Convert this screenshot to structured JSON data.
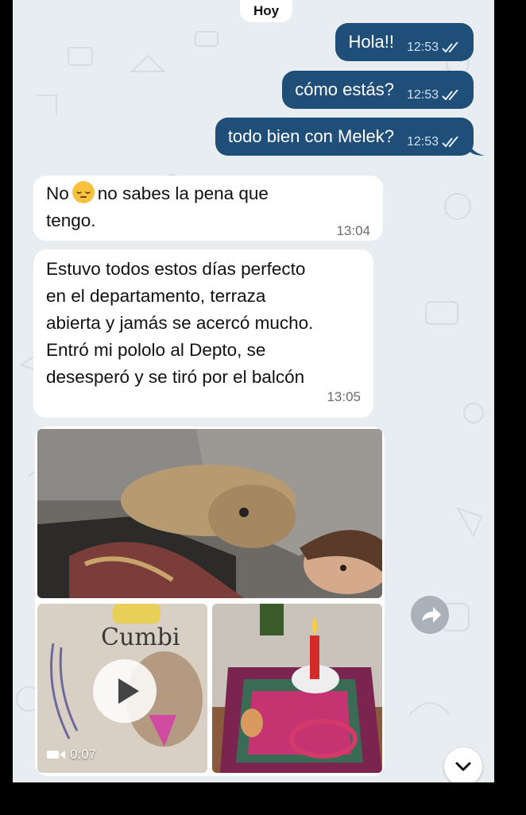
{
  "date_separator": "Hoy",
  "outgoing": [
    {
      "text": "Hola!!",
      "time": "12:53"
    },
    {
      "text": "cómo estás?",
      "time": "12:53"
    },
    {
      "text": "todo bien con Melek?",
      "time": "12:53"
    }
  ],
  "incoming": [
    {
      "text_before_emoji": "No",
      "emoji": "pensive-face-emoji",
      "text_after_emoji": "no sabes la pena que\ntengo.",
      "time": "13:04"
    },
    {
      "text": "Estuvo todos estos días perfecto\nen el departamento, terraza\nabierta y jamás se acercó mucho.\nEntró mi pololo al Depto, se\ndesesperó y se tiró por el balcón",
      "time": "13:05"
    }
  ],
  "album": {
    "video_duration": "0:07",
    "video_drawing_text": "Cumbi"
  },
  "icons": {
    "read_ticks": "double-check-icon",
    "forward": "forward-arrow-icon",
    "scroll_down": "chevron-down-icon",
    "play": "play-icon",
    "video_camera": "video-camera-icon"
  },
  "colors": {
    "outgoing_bubble": "#1f4e79",
    "incoming_bubble": "#ffffff",
    "chat_background": "#e8edf1"
  }
}
